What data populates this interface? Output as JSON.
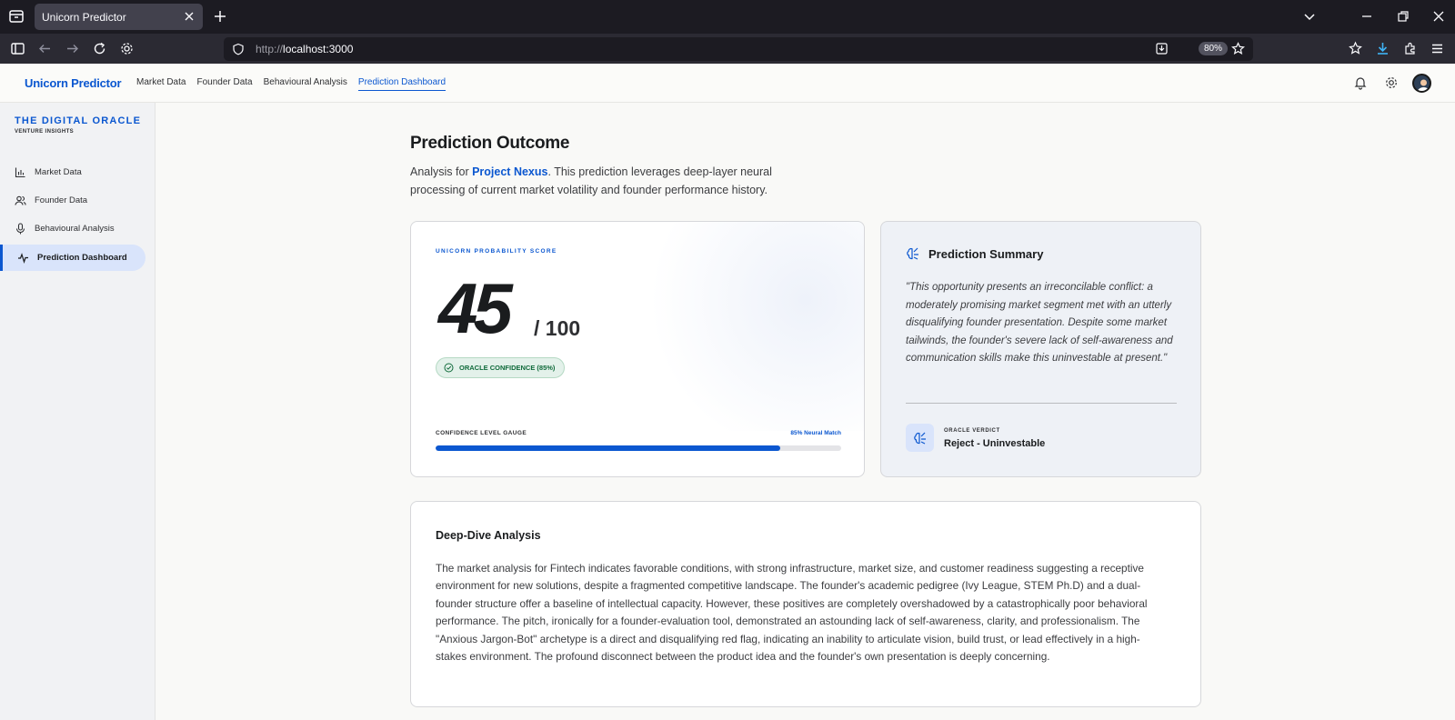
{
  "browser": {
    "tab_title": "Unicorn Predictor",
    "url_proto": "http://",
    "url_host": "localhost:3000",
    "zoom": "80%"
  },
  "header": {
    "brand": "Unicorn Predictor",
    "nav": [
      {
        "label": "Market Data"
      },
      {
        "label": "Founder Data"
      },
      {
        "label": "Behavioural Analysis"
      },
      {
        "label": "Prediction Dashboard"
      }
    ]
  },
  "sidebar": {
    "title": "THE DIGITAL ORACLE",
    "subtitle": "VENTURE INSIGHTS",
    "items": [
      {
        "label": "Market Data",
        "icon": "bar-chart-icon"
      },
      {
        "label": "Founder Data",
        "icon": "users-icon"
      },
      {
        "label": "Behavioural Analysis",
        "icon": "microphone-icon"
      },
      {
        "label": "Prediction Dashboard",
        "icon": "pulse-icon"
      }
    ]
  },
  "main": {
    "title": "Prediction Outcome",
    "desc_prefix": "Analysis for ",
    "project": "Project Nexus",
    "desc_suffix": ". This prediction leverages deep-layer neural processing of current market volatility and founder performance history."
  },
  "score": {
    "label": "UNICORN PROBABILITY SCORE",
    "value": "45",
    "max": "/ 100",
    "confidence": "ORACLE CONFIDENCE (85%)",
    "gauge_label": "CONFIDENCE LEVEL GAUGE",
    "gauge_match": "85% Neural Match",
    "gauge_fraction": 0.85
  },
  "summary": {
    "title": "Prediction Summary",
    "quote": "\"This opportunity presents an irreconcilable conflict: a moderately promising market segment met with an utterly disqualifying founder presentation. Despite some market tailwinds, the founder's severe lack of self-awareness and communication skills make this uninvestable at present.\"",
    "verdict_label": "ORACLE VERDICT",
    "verdict_value": "Reject - Uninvestable"
  },
  "deep_dive": {
    "title": "Deep-Dive Analysis",
    "body": "The market analysis for Fintech indicates favorable conditions, with strong infrastructure, market size, and customer readiness suggesting a receptive environment for new solutions, despite a fragmented competitive landscape. The founder's academic pedigree (Ivy League, STEM Ph.D) and a dual-founder structure offer a baseline of intellectual capacity. However, these positives are completely overshadowed by a catastrophically poor behavioral performance. The pitch, ironically for a founder-evaluation tool, demonstrated an astounding lack of self-awareness, clarity, and professionalism. The \"Anxious Jargon-Bot\" archetype is a direct and disqualifying red flag, indicating an inability to articulate vision, build trust, or lead effectively in a high-stakes environment. The profound disconnect between the product idea and the founder's own presentation is deeply concerning."
  },
  "colors": {
    "accent": "#0b57d0",
    "confidence_green": "#0f6a3a"
  }
}
